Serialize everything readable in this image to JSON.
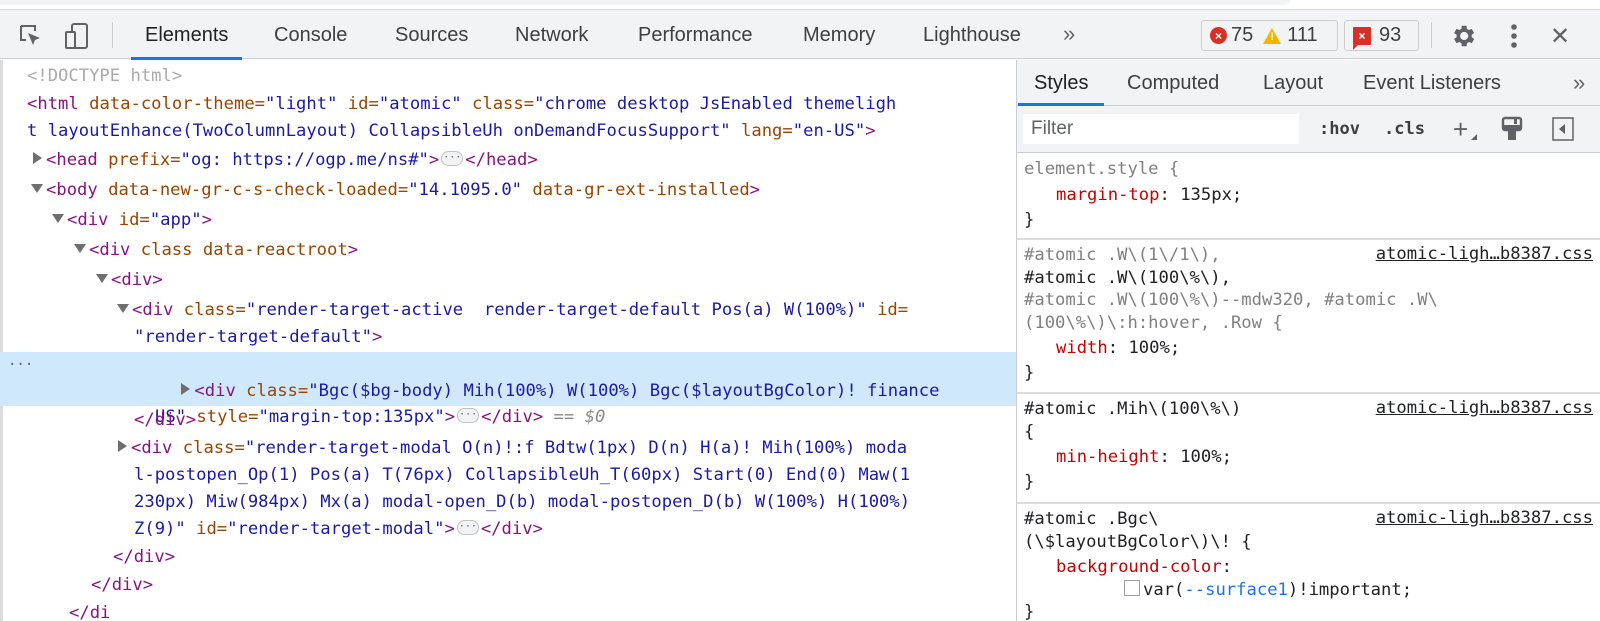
{
  "toolbar": {
    "inspect_icon": "inspect-element-icon",
    "device_icon": "device-toolbar-icon",
    "tabs": [
      {
        "label": "Elements",
        "active": true
      },
      {
        "label": "Console"
      },
      {
        "label": "Sources"
      },
      {
        "label": "Network"
      },
      {
        "label": "Performance"
      },
      {
        "label": "Memory"
      },
      {
        "label": "Lighthouse"
      }
    ],
    "more_tabs": "»",
    "errors": "75",
    "warnings": "111",
    "issues": "93",
    "settings_icon": "gear-icon",
    "menu_icon": "kebab-menu-icon",
    "close": "✕",
    "colors": {
      "accent": "#1a73e8",
      "error": "#d93025",
      "warning": "#f2b600"
    }
  },
  "dom": {
    "doctype": "<!DOCTYPE html>",
    "html_open_a": "<html",
    "html_attr1": " data-color-theme=",
    "html_val1": "\"light\"",
    "html_attr2": " id=",
    "html_val2": "\"atomic\"",
    "html_attr3": " class=",
    "html_val3a": "\"chrome desktop JsEnabled themeligh",
    "html_val3b": "t layoutEnhance(TwoColumnLayout) CollapsibleUh onDemandFocusSupport\"",
    "html_attr4": " lang=",
    "html_val4": "\"en-US\"",
    "html_close": ">",
    "head_open": "<head",
    "head_attr": " prefix=",
    "head_val": "\"og: https://ogp.me/ns#\"",
    "gt": ">",
    "head_close": "</head>",
    "body_open": "<body",
    "body_attr1": " data-new-gr-c-s-check-loaded=",
    "body_val1": "\"14.1095.0\"",
    "body_attr2": " data-gr-ext-installed",
    "div_open": "<div",
    "app_attr": " id=",
    "app_val": "\"app\"",
    "reactroot_attr": " class data-reactroot",
    "div_plain": "<div>",
    "rt_attr": " class=",
    "rt_val": "\"render-target-active  render-target-default Pos(a) W(100%)\"",
    "rt_id_attr": " id=",
    "rt_id_val": "\"render-target-default\"",
    "sel_attr": " class=",
    "sel_val_a": "\"Bgc($bg-body) Mih(100%) W(100%) Bgc($layoutBgColor)! finance",
    "sel_val_b": "US\"",
    "sel_style_attr": " style=",
    "sel_style_val": "\"margin-top:135px\"",
    "div_close": "</div>",
    "eq": " == $0",
    "modal_attr": " class=",
    "modal_val_1": "\"render-target-modal O(n)!:f Bdtw(1px) D(n) H(a)! Mih(100%) moda",
    "modal_val_2": "l-postopen_Op(1) Pos(a) T(76px) CollapsibleUh_T(60px) Start(0) End(0) Maw(1",
    "modal_val_3": "230px) Miw(984px) Mx(a) modal-open_D(b) modal-postopen_D(b) W(100%) H(100%)",
    "modal_val_4": "Z(9)\"",
    "modal_id_attr": " id=",
    "modal_id_val": "\"render-target-modal\"",
    "row_dots": "···",
    "ellipsis": "···",
    "partial_close": "</di"
  },
  "styles": {
    "tabs": [
      {
        "label": "Styles",
        "active": true
      },
      {
        "label": "Computed"
      },
      {
        "label": "Layout"
      },
      {
        "label": "Event Listeners"
      }
    ],
    "more_tabs": "»",
    "filter_placeholder": "Filter",
    "hov": ":hov",
    "cls": ".cls",
    "plus": "+",
    "rules": [
      {
        "selector": "element.style {",
        "props": [
          {
            "name": "margin-top",
            "value": "135px;"
          }
        ],
        "close": "}"
      },
      {
        "selector_lines": [
          "#atomic .W\\(1\\/1\\),",
          "#atomic .W\\(100\\%\\),",
          "#atomic .W\\(100\\%\\)--mdw320, #atomic .W\\",
          "(100\\%\\)\\:h:hover, .Row {"
        ],
        "source": "atomic-ligh…b8387.css",
        "props": [
          {
            "name": "width",
            "value": "100%;"
          }
        ],
        "close": "}"
      },
      {
        "selector_lines": [
          "#atomic .Mih\\(100\\%\\)",
          "{"
        ],
        "source": "atomic-ligh…b8387.css",
        "props": [
          {
            "name": "min-height",
            "value": "100%;"
          }
        ],
        "close": "}"
      },
      {
        "selector_lines": [
          "#atomic .Bgc\\",
          "(\\$layoutBgColor\\)\\! {"
        ],
        "source": "atomic-ligh…b8387.css",
        "props": [
          {
            "name": "background-color",
            "value_pre": "var(",
            "value_var": "--surface1",
            "value_post": ")!important;"
          }
        ],
        "close": "}"
      }
    ]
  }
}
